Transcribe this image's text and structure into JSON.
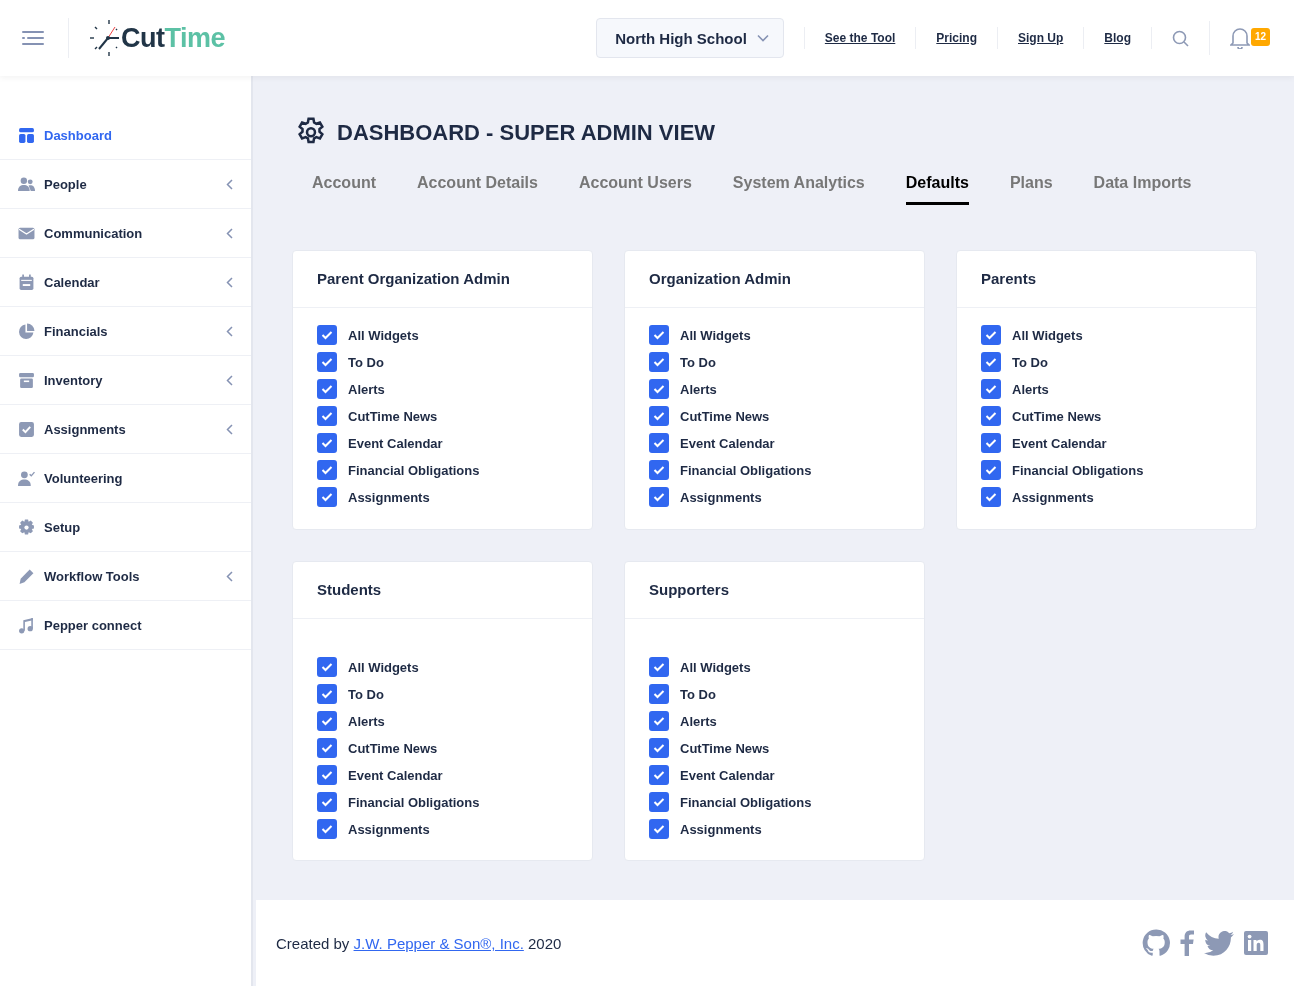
{
  "header": {
    "logo": {
      "part_1": "Cut",
      "part_2": "Time"
    },
    "school_select": "North High School",
    "links": [
      "See the Tool",
      "Pricing",
      "Sign Up",
      "Blog"
    ],
    "notification_count": "12"
  },
  "sidebar": {
    "items": [
      {
        "label": "Dashboard",
        "selected": true,
        "expandable": false
      },
      {
        "label": "People",
        "selected": false,
        "expandable": true
      },
      {
        "label": "Communication",
        "selected": false,
        "expandable": true
      },
      {
        "label": "Calendar",
        "selected": false,
        "expandable": true
      },
      {
        "label": "Financials",
        "selected": false,
        "expandable": true
      },
      {
        "label": "Inventory",
        "selected": false,
        "expandable": true
      },
      {
        "label": "Assignments",
        "selected": false,
        "expandable": true
      },
      {
        "label": "Volunteering",
        "selected": false,
        "expandable": false
      },
      {
        "label": "Setup",
        "selected": false,
        "expandable": false
      },
      {
        "label": "Workflow Tools",
        "selected": false,
        "expandable": true
      },
      {
        "label": "Pepper connect",
        "selected": false,
        "expandable": false
      }
    ]
  },
  "page": {
    "title": "DASHBOARD - SUPER ADMIN VIEW",
    "tabs": [
      {
        "label": "Account",
        "selected": false
      },
      {
        "label": "Account Details",
        "selected": false
      },
      {
        "label": "Account Users",
        "selected": false
      },
      {
        "label": "System Analytics",
        "selected": false
      },
      {
        "label": "Defaults",
        "selected": true
      },
      {
        "label": "Plans",
        "selected": false
      },
      {
        "label": "Data Imports",
        "selected": false
      }
    ],
    "cards": [
      {
        "title": "Parent Organization Admin",
        "options": [
          {
            "label": "All Widgets",
            "checked": true
          },
          {
            "label": "To Do",
            "checked": true
          },
          {
            "label": "Alerts",
            "checked": true
          },
          {
            "label": "CutTime News",
            "checked": true
          },
          {
            "label": "Event Calendar",
            "checked": true
          },
          {
            "label": "Financial Obligations",
            "checked": true
          },
          {
            "label": "Assignments",
            "checked": true
          }
        ]
      },
      {
        "title": "Organization Admin",
        "options": [
          {
            "label": "All Widgets",
            "checked": true
          },
          {
            "label": "To Do",
            "checked": true
          },
          {
            "label": "Alerts",
            "checked": true
          },
          {
            "label": "CutTime News",
            "checked": true
          },
          {
            "label": "Event Calendar",
            "checked": true
          },
          {
            "label": "Financial Obligations",
            "checked": true
          },
          {
            "label": "Assignments",
            "checked": true
          }
        ]
      },
      {
        "title": "Parents",
        "options": [
          {
            "label": "All Widgets",
            "checked": true
          },
          {
            "label": "To Do",
            "checked": true
          },
          {
            "label": "Alerts",
            "checked": true
          },
          {
            "label": "CutTime News",
            "checked": true
          },
          {
            "label": "Event Calendar",
            "checked": true
          },
          {
            "label": "Financial Obligations",
            "checked": true
          },
          {
            "label": "Assignments",
            "checked": true
          }
        ]
      },
      {
        "title": "Students",
        "options": [
          {
            "label": "All Widgets",
            "checked": true
          },
          {
            "label": "To Do",
            "checked": true
          },
          {
            "label": "Alerts",
            "checked": true
          },
          {
            "label": "CutTime News",
            "checked": true
          },
          {
            "label": "Event Calendar",
            "checked": true
          },
          {
            "label": "Financial Obligations",
            "checked": true
          },
          {
            "label": "Assignments",
            "checked": true
          }
        ]
      },
      {
        "title": "Supporters",
        "options": [
          {
            "label": "All Widgets",
            "checked": true
          },
          {
            "label": "To Do",
            "checked": true
          },
          {
            "label": "Alerts",
            "checked": true
          },
          {
            "label": "CutTime News",
            "checked": true
          },
          {
            "label": "Event Calendar",
            "checked": true
          },
          {
            "label": "Financial Obligations",
            "checked": true
          },
          {
            "label": "Assignments",
            "checked": true
          }
        ]
      }
    ]
  },
  "footer": {
    "prefix": "Created by",
    "link": "J.W. Pepper & Son®, Inc.",
    "year": "2020"
  }
}
